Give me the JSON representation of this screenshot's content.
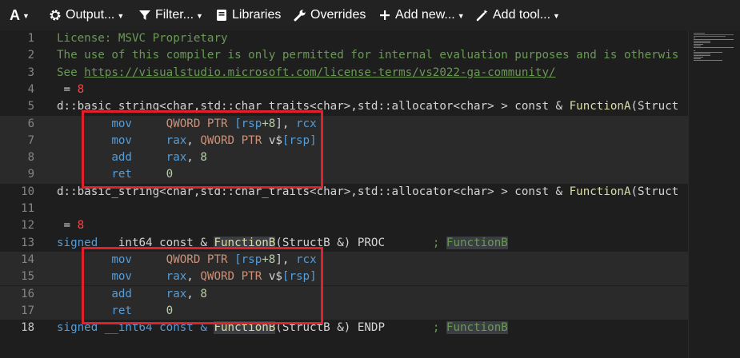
{
  "toolbar": {
    "font_label": "A",
    "output_label": "Output...",
    "filter_label": "Filter...",
    "libraries_label": "Libraries",
    "overrides_label": "Overrides",
    "add_new_label": "Add new...",
    "add_tool_label": "Add tool..."
  },
  "lines": [
    {
      "num": "1",
      "segments": [
        {
          "t": "License: MSVC Proprietary",
          "c": "c-comment"
        }
      ]
    },
    {
      "num": "2",
      "segments": [
        {
          "t": "The use of this compiler is only permitted for internal evaluation purposes and is otherwis",
          "c": "c-comment"
        }
      ]
    },
    {
      "num": "3",
      "segments": [
        {
          "t": "See ",
          "c": "c-comment"
        },
        {
          "t": "https://visualstudio.microsoft.com/license-terms/vs2022-ga-community/",
          "c": "c-link"
        }
      ]
    },
    {
      "num": "4",
      "segments": [
        {
          "t": " = ",
          "c": ""
        },
        {
          "t": "8",
          "c": "c-num"
        }
      ]
    },
    {
      "num": "5",
      "segments": [
        {
          "t": "d::basic_string<char,std::char_traits<char>,std::allocator<char> > const & ",
          "c": ""
        },
        {
          "t": "FunctionA",
          "c": "c-func"
        },
        {
          "t": "(Struct",
          "c": ""
        }
      ]
    },
    {
      "num": "6",
      "segments": [
        {
          "t": "        mov     ",
          "c": "c-op"
        },
        {
          "t": "QWORD PTR ",
          "c": "c-ptr"
        },
        {
          "t": "[rsp",
          "c": "c-reg"
        },
        {
          "t": "+8",
          "c": "c-lit"
        },
        {
          "t": "], ",
          "c": ""
        },
        {
          "t": "rcx",
          "c": "c-reg"
        }
      ]
    },
    {
      "num": "7",
      "segments": [
        {
          "t": "        mov     ",
          "c": "c-op"
        },
        {
          "t": "rax",
          "c": "c-reg"
        },
        {
          "t": ", ",
          "c": ""
        },
        {
          "t": "QWORD PTR ",
          "c": "c-ptr"
        },
        {
          "t": "v$",
          "c": ""
        },
        {
          "t": "[rsp]",
          "c": "c-reg"
        }
      ]
    },
    {
      "num": "8",
      "segments": [
        {
          "t": "        add     ",
          "c": "c-op"
        },
        {
          "t": "rax",
          "c": "c-reg"
        },
        {
          "t": ", ",
          "c": ""
        },
        {
          "t": "8",
          "c": "c-lit"
        }
      ]
    },
    {
      "num": "9",
      "segments": [
        {
          "t": "        ret     ",
          "c": "c-op"
        },
        {
          "t": "0",
          "c": "c-lit"
        }
      ]
    },
    {
      "num": "10",
      "segments": [
        {
          "t": "d::basic_string<char,std::char_traits<char>,std::allocator<char> > const & ",
          "c": ""
        },
        {
          "t": "FunctionA",
          "c": "c-func"
        },
        {
          "t": "(Struct",
          "c": ""
        }
      ]
    },
    {
      "num": "11",
      "segments": []
    },
    {
      "num": "12",
      "segments": [
        {
          "t": " = ",
          "c": ""
        },
        {
          "t": "8",
          "c": "c-num"
        }
      ]
    },
    {
      "num": "13",
      "segments": [
        {
          "t": "signed   ",
          "c": "c-op"
        },
        {
          "t": "int64 const & ",
          "c": ""
        },
        {
          "t": "FunctionB",
          "c": "c-func c-box"
        },
        {
          "t": "(StructB &) PROC       ",
          "c": ""
        },
        {
          "t": "; ",
          "c": "c-comment"
        },
        {
          "t": "FunctionB",
          "c": "c-comment c-box"
        }
      ]
    },
    {
      "num": "14",
      "segments": [
        {
          "t": "        mov     ",
          "c": "c-op"
        },
        {
          "t": "QWORD PTR ",
          "c": "c-ptr"
        },
        {
          "t": "[rsp",
          "c": "c-reg"
        },
        {
          "t": "+8",
          "c": "c-lit"
        },
        {
          "t": "], ",
          "c": ""
        },
        {
          "t": "rcx",
          "c": "c-reg"
        }
      ]
    },
    {
      "num": "15",
      "segments": [
        {
          "t": "        mov     ",
          "c": "c-op"
        },
        {
          "t": "rax",
          "c": "c-reg"
        },
        {
          "t": ", ",
          "c": ""
        },
        {
          "t": "QWORD PTR ",
          "c": "c-ptr"
        },
        {
          "t": "v$",
          "c": ""
        },
        {
          "t": "[rsp]",
          "c": "c-reg"
        }
      ]
    },
    {
      "num": "16",
      "segments": [
        {
          "t": "        add     ",
          "c": "c-op"
        },
        {
          "t": "rax",
          "c": "c-reg"
        },
        {
          "t": ", ",
          "c": ""
        },
        {
          "t": "8",
          "c": "c-lit"
        }
      ]
    },
    {
      "num": "17",
      "segments": [
        {
          "t": "        ret     ",
          "c": "c-op"
        },
        {
          "t": "0",
          "c": "c-lit"
        }
      ]
    },
    {
      "num": "18",
      "segments": [
        {
          "t": "signed __int64 const & ",
          "c": "c-op"
        },
        {
          "t": "FunctionB",
          "c": "c-func c-box"
        },
        {
          "t": "(StructB &) ENDP       ",
          "c": ""
        },
        {
          "t": "; ",
          "c": "c-comment"
        },
        {
          "t": "FunctionB",
          "c": "c-comment c-box"
        }
      ]
    }
  ],
  "current_line": "18",
  "highlighted_lines": [
    "6",
    "7",
    "8",
    "9",
    "14",
    "15",
    "16",
    "17"
  ],
  "colors": {
    "annotation_red": "#e0202a",
    "background": "#1e1e1e",
    "toolbar": "#222222"
  }
}
